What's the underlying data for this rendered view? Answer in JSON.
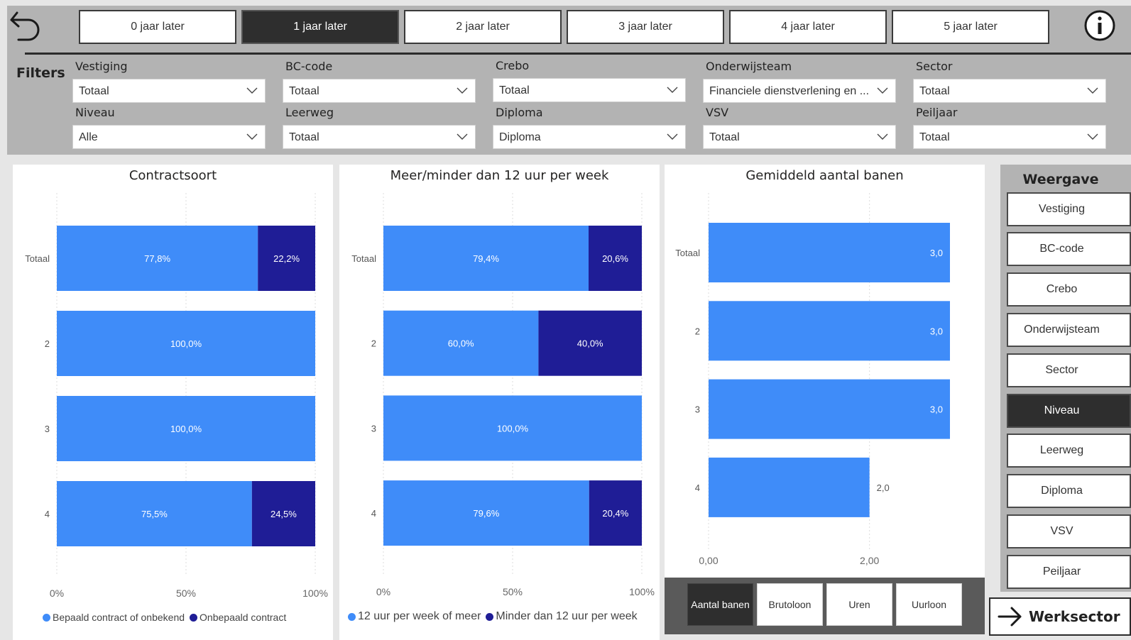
{
  "year_tabs": [
    {
      "label": "0 jaar later",
      "active": false
    },
    {
      "label": "1 jaar later",
      "active": true
    },
    {
      "label": "2 jaar later",
      "active": false
    },
    {
      "label": "3 jaar later",
      "active": false
    },
    {
      "label": "4 jaar later",
      "active": false
    },
    {
      "label": "5 jaar later",
      "active": false
    }
  ],
  "filters": {
    "label": "Filters",
    "items": [
      {
        "label": "Vestiging",
        "value": "Totaal"
      },
      {
        "label": "BC-code",
        "value": "Totaal"
      },
      {
        "label": "Crebo",
        "value": "Totaal"
      },
      {
        "label": "Onderwijsteam",
        "value": "Financiele dienstverlening en ..."
      },
      {
        "label": "Sector",
        "value": "Totaal"
      },
      {
        "label": "Niveau",
        "value": "Alle"
      },
      {
        "label": "Leerweg",
        "value": "Totaal"
      },
      {
        "label": "Diploma",
        "value": "Diploma"
      },
      {
        "label": "VSV",
        "value": "Totaal"
      },
      {
        "label": "Peiljaar",
        "value": "Totaal"
      }
    ]
  },
  "colors": {
    "series_light": "#3f8cf9",
    "series_dark": "#1f1d96",
    "dark_button": "#2e2e2e"
  },
  "chart_data": [
    {
      "type": "bar",
      "orientation": "horizontal",
      "stacked": "100%",
      "title": "Contractsoort",
      "categories": [
        "Totaal",
        "2",
        "3",
        "4"
      ],
      "series": [
        {
          "name": "Bepaald contract of onbekend",
          "values": [
            77.8,
            100.0,
            100.0,
            75.5
          ],
          "labels": [
            "77,8%",
            "100,0%",
            "100,0%",
            "75,5%"
          ]
        },
        {
          "name": "Onbepaald contract",
          "values": [
            22.2,
            0,
            0,
            24.5
          ],
          "labels": [
            "22,2%",
            "",
            "",
            "24,5%"
          ]
        }
      ],
      "xticks": [
        "0%",
        "50%",
        "100%"
      ],
      "xlim": [
        0,
        100
      ],
      "legend": "bottom"
    },
    {
      "type": "bar",
      "orientation": "horizontal",
      "stacked": "100%",
      "title": "Meer/minder dan 12 uur per week",
      "categories": [
        "Totaal",
        "2",
        "3",
        "4"
      ],
      "series": [
        {
          "name": "12 uur per week of meer",
          "values": [
            79.4,
            60.0,
            100.0,
            79.6
          ],
          "labels": [
            "79,4%",
            "60,0%",
            "100,0%",
            "79,6%"
          ]
        },
        {
          "name": "Minder dan 12 uur per week",
          "values": [
            20.6,
            40.0,
            0,
            20.4
          ],
          "labels": [
            "20,6%",
            "40,0%",
            "",
            "20,4%"
          ]
        }
      ],
      "xticks": [
        "0%",
        "50%",
        "100%"
      ],
      "xlim": [
        0,
        100
      ],
      "legend": "bottom"
    },
    {
      "type": "bar",
      "orientation": "horizontal",
      "title": "Gemiddeld aantal banen",
      "categories": [
        "Totaal",
        "2",
        "3",
        "4"
      ],
      "series": [
        {
          "values": [
            3.0,
            3.0,
            3.0,
            2.0
          ],
          "labels": [
            "3,0",
            "3,0",
            "3,0",
            "2,0"
          ]
        }
      ],
      "xticks": [
        "0,00",
        "2,00"
      ],
      "xlim": [
        0,
        3.0
      ]
    }
  ],
  "metric_buttons": [
    {
      "label": "Aantal banen",
      "active": true
    },
    {
      "label": "Brutoloon",
      "active": false
    },
    {
      "label": "Uren",
      "active": false
    },
    {
      "label": "Uurloon",
      "active": false
    }
  ],
  "weergave": {
    "title": "Weergave",
    "items": [
      {
        "label": "Vestiging",
        "active": false
      },
      {
        "label": "BC-code",
        "active": false
      },
      {
        "label": "Crebo",
        "active": false
      },
      {
        "label": "Onderwijsteam",
        "active": false
      },
      {
        "label": "Sector",
        "active": false
      },
      {
        "label": "Niveau",
        "active": true
      },
      {
        "label": "Leerweg",
        "active": false
      },
      {
        "label": "Diploma",
        "active": false
      },
      {
        "label": "VSV",
        "active": false
      },
      {
        "label": "Peiljaar",
        "active": false
      }
    ]
  },
  "werksector": {
    "label": "Werksector",
    "icon": "arrow-right-icon"
  }
}
